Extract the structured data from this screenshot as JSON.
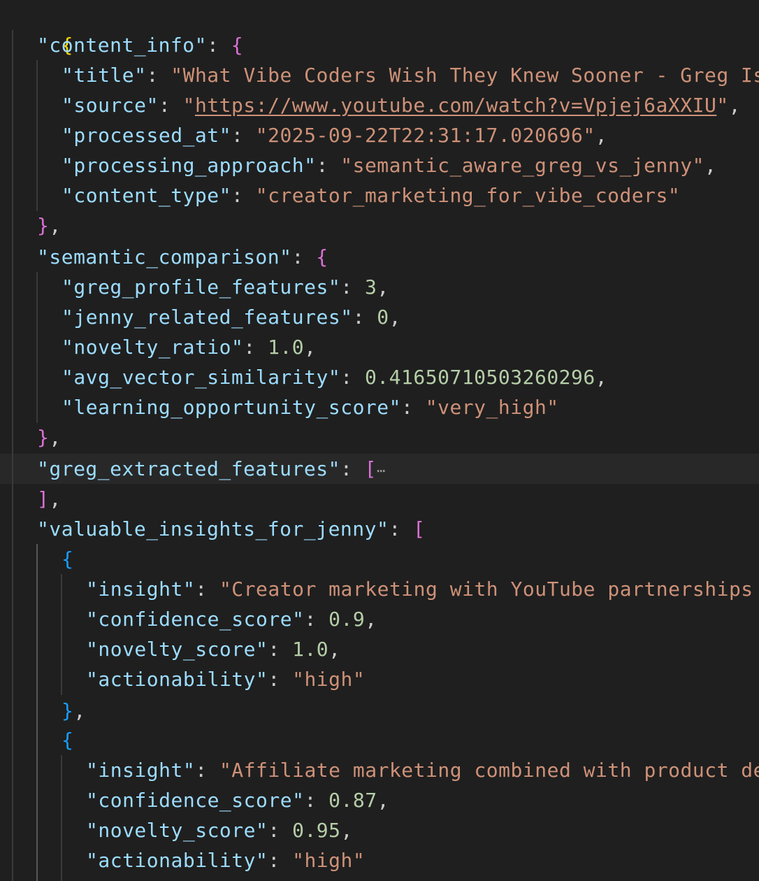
{
  "editor": {
    "lines": {
      "l1": {
        "open": "{"
      },
      "l2": {
        "key": "\"content_info\"",
        "colon": ": ",
        "open": "{"
      },
      "l3": {
        "key": "\"title\"",
        "colon": ": ",
        "value": "\"What Vibe Coders Wish They Knew Sooner - Greg Is"
      },
      "l4": {
        "key": "\"source\"",
        "colon": ": ",
        "quote_open": "\"",
        "url": "https://www.youtube.com/watch?v=Vpjej6aXXIU",
        "quote_close": "\"",
        "comma": ","
      },
      "l5": {
        "key": "\"processed_at\"",
        "colon": ": ",
        "value": "\"2025-09-22T22:31:17.020696\"",
        "comma": ","
      },
      "l6": {
        "key": "\"processing_approach\"",
        "colon": ": ",
        "value": "\"semantic_aware_greg_vs_jenny\"",
        "comma": ","
      },
      "l7": {
        "key": "\"content_type\"",
        "colon": ": ",
        "value": "\"creator_marketing_for_vibe_coders\""
      },
      "l8": {
        "close": "}",
        "comma": ","
      },
      "l9": {
        "key": "\"semantic_comparison\"",
        "colon": ": ",
        "open": "{"
      },
      "l10": {
        "key": "\"greg_profile_features\"",
        "colon": ": ",
        "value": "3",
        "comma": ","
      },
      "l11": {
        "key": "\"jenny_related_features\"",
        "colon": ": ",
        "value": "0",
        "comma": ","
      },
      "l12": {
        "key": "\"novelty_ratio\"",
        "colon": ": ",
        "value": "1.0",
        "comma": ","
      },
      "l13": {
        "key": "\"avg_vector_similarity\"",
        "colon": ": ",
        "value": "0.41650710503260296",
        "comma": ","
      },
      "l14": {
        "key": "\"learning_opportunity_score\"",
        "colon": ": ",
        "value": "\"very_high\""
      },
      "l15": {
        "close": "}",
        "comma": ","
      },
      "l16": {
        "key": "\"greg_extracted_features\"",
        "colon": ": ",
        "open": "[",
        "ellipsis": "⋯"
      },
      "l17": {
        "close": "]",
        "comma": ","
      },
      "l18": {
        "key": "\"valuable_insights_for_jenny\"",
        "colon": ": ",
        "open": "["
      },
      "l19": {
        "open": "{"
      },
      "l20": {
        "key": "\"insight\"",
        "colon": ": ",
        "value": "\"Creator marketing with YouTube partnerships"
      },
      "l21": {
        "key": "\"confidence_score\"",
        "colon": ": ",
        "value": "0.9",
        "comma": ","
      },
      "l22": {
        "key": "\"novelty_score\"",
        "colon": ": ",
        "value": "1.0",
        "comma": ","
      },
      "l23": {
        "key": "\"actionability\"",
        "colon": ": ",
        "value": "\"high\""
      },
      "l24": {
        "close": "}",
        "comma": ","
      },
      "l25": {
        "open": "{"
      },
      "l26": {
        "key": "\"insight\"",
        "colon": ": ",
        "value": "\"Affiliate marketing combined with product de"
      },
      "l27": {
        "key": "\"confidence_score\"",
        "colon": ": ",
        "value": "0.87",
        "comma": ","
      },
      "l28": {
        "key": "\"novelty_score\"",
        "colon": ": ",
        "value": "0.95",
        "comma": ","
      },
      "l29": {
        "key": "\"actionability\"",
        "colon": ": ",
        "value": "\"high\""
      }
    }
  },
  "colors": {
    "background": "#1f1f1f",
    "key": "#9cdcfe",
    "string": "#ce9178",
    "number": "#b5cea8",
    "bracket_level_1": "#ffd700",
    "bracket_level_2": "#da70d6",
    "bracket_level_3": "#179fff"
  }
}
